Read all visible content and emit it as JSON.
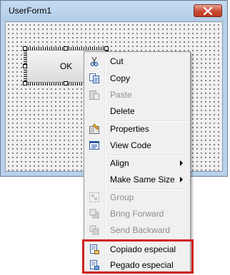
{
  "window": {
    "title": "UserForm1",
    "close_icon": "close-icon"
  },
  "form": {
    "ok_button_label": "OK"
  },
  "context_menu": {
    "items": [
      {
        "label": "Cut",
        "icon": "scissors-icon",
        "enabled": true
      },
      {
        "label": "Copy",
        "icon": "copy-icon",
        "enabled": true
      },
      {
        "label": "Paste",
        "icon": "paste-icon",
        "enabled": false
      },
      {
        "label": "Delete",
        "icon": "",
        "enabled": true
      },
      {
        "label": "Properties",
        "icon": "properties-icon",
        "enabled": true
      },
      {
        "label": "View Code",
        "icon": "view-code-icon",
        "enabled": true
      },
      {
        "label": "Align",
        "icon": "",
        "enabled": true,
        "submenu": true
      },
      {
        "label": "Make Same Size",
        "icon": "",
        "enabled": true,
        "submenu": true
      },
      {
        "label": "Group",
        "icon": "group-icon",
        "enabled": false
      },
      {
        "label": "Bring Forward",
        "icon": "bring-forward-icon",
        "enabled": false
      },
      {
        "label": "Send Backward",
        "icon": "send-backward-icon",
        "enabled": false
      },
      {
        "label": "Copiado especial",
        "icon": "special-copy-icon",
        "enabled": true
      },
      {
        "label": "Pegado especial",
        "icon": "special-paste-icon",
        "enabled": true
      }
    ]
  },
  "colors": {
    "highlight_border": "#d01f1f",
    "disabled_text": "#8d8d8d",
    "title_bar": "#b9d1ea",
    "close_button": "#c94a34"
  }
}
